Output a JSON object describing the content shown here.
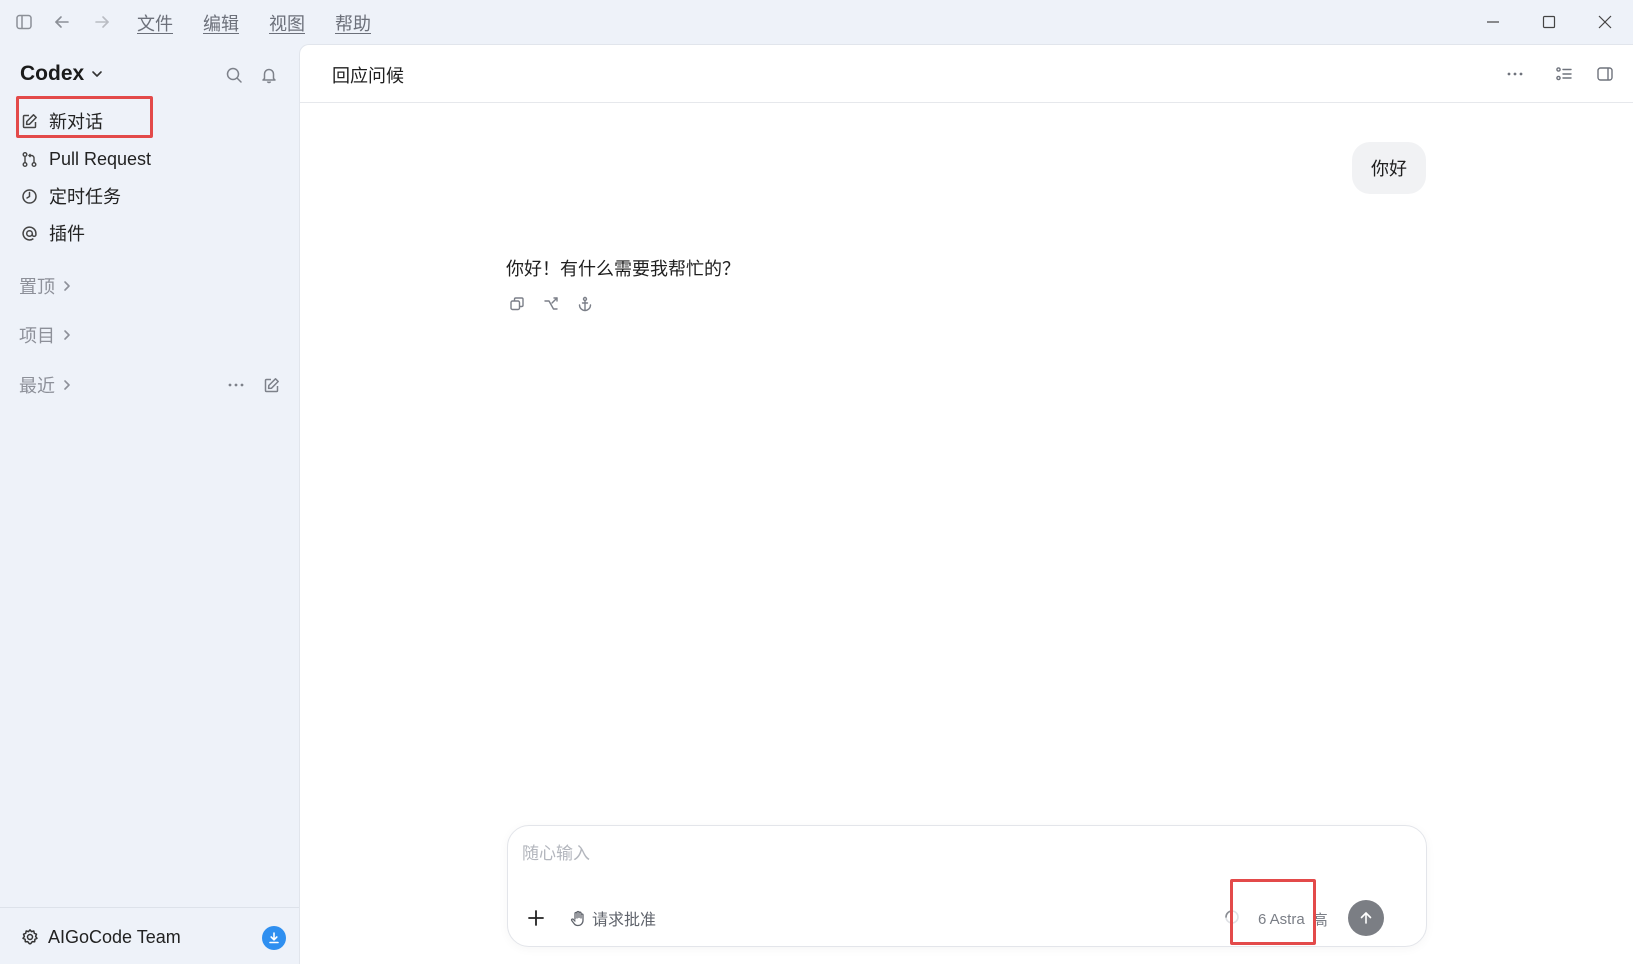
{
  "menu": [
    "文件",
    "编辑",
    "视图",
    "帮助"
  ],
  "sidebar": {
    "brand": "Codex",
    "nav": [
      {
        "label": "新对话",
        "icon": "edit-icon"
      },
      {
        "label": "Pull Request",
        "icon": "git-pull-request-icon"
      },
      {
        "label": "定时任务",
        "icon": "clock-icon"
      },
      {
        "label": "插件",
        "icon": "at-sign-icon"
      }
    ],
    "sections": [
      "置顶",
      "项目",
      "最近"
    ],
    "footer": {
      "label": "AIGoCode Team"
    }
  },
  "chat": {
    "title": "回应问候",
    "user_message": "你好",
    "assistant_message": "你好！有什么需要我帮忙的？"
  },
  "composer": {
    "placeholder": "随心输入",
    "approve_label": "请求批准",
    "model_label": "6 Astra",
    "level_label": "高"
  },
  "colors": {
    "accent_highlight": "#e34a4a",
    "download_badge": "#2f8ff0",
    "send_button": "#7b7e84"
  }
}
